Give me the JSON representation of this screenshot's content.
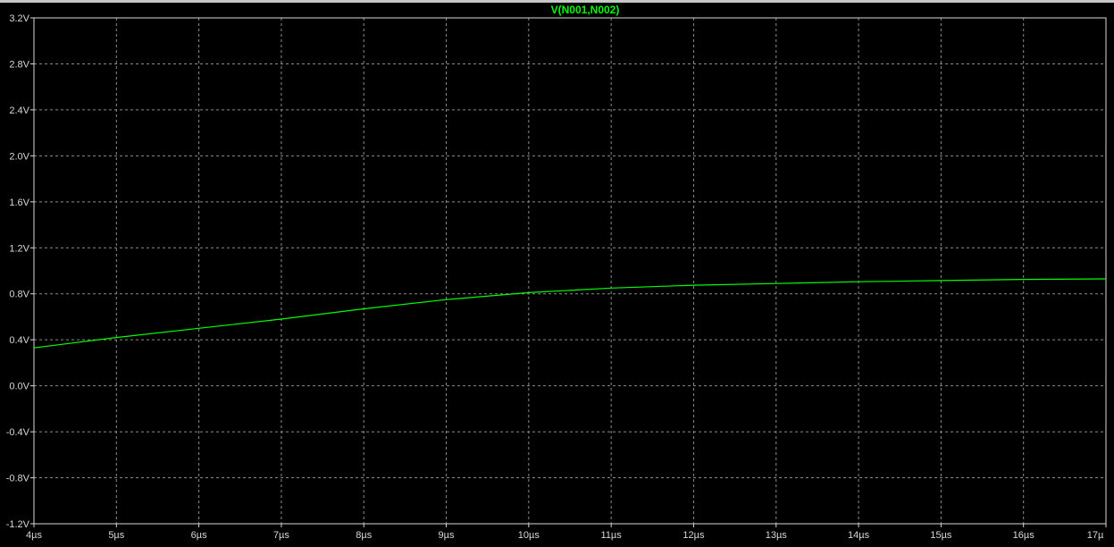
{
  "colors": {
    "background": "#000000",
    "grid": "#8c8c8c",
    "axis": "#d8d8d8",
    "trace": "#00ff00"
  },
  "chart_data": {
    "type": "line",
    "title": "V(N001,N002)",
    "xlabel": "",
    "ylabel": "",
    "grid": true,
    "xlim": [
      4,
      17
    ],
    "ylim": [
      -1.2,
      3.2
    ],
    "x_unit": "µs",
    "y_unit": "V",
    "x_ticks": [
      "4µs",
      "5µs",
      "6µs",
      "7µs",
      "8µs",
      "9µs",
      "10µs",
      "11µs",
      "12µs",
      "13µs",
      "14µs",
      "15µs",
      "16µs",
      "17µ"
    ],
    "y_ticks": [
      "3.2V",
      "2.8V",
      "2.4V",
      "2.0V",
      "1.6V",
      "1.2V",
      "0.8V",
      "0.4V",
      "0.0V",
      "-0.4V",
      "-0.8V",
      "-1.2V"
    ],
    "series": [
      {
        "name": "V(N001,N002)",
        "color": "#00ff00",
        "x": [
          4,
          5,
          6,
          7,
          8,
          9,
          10,
          11,
          12,
          13,
          14,
          15,
          16,
          17
        ],
        "y": [
          0.33,
          0.42,
          0.5,
          0.58,
          0.67,
          0.75,
          0.81,
          0.85,
          0.875,
          0.89,
          0.905,
          0.915,
          0.925,
          0.93
        ]
      }
    ]
  }
}
